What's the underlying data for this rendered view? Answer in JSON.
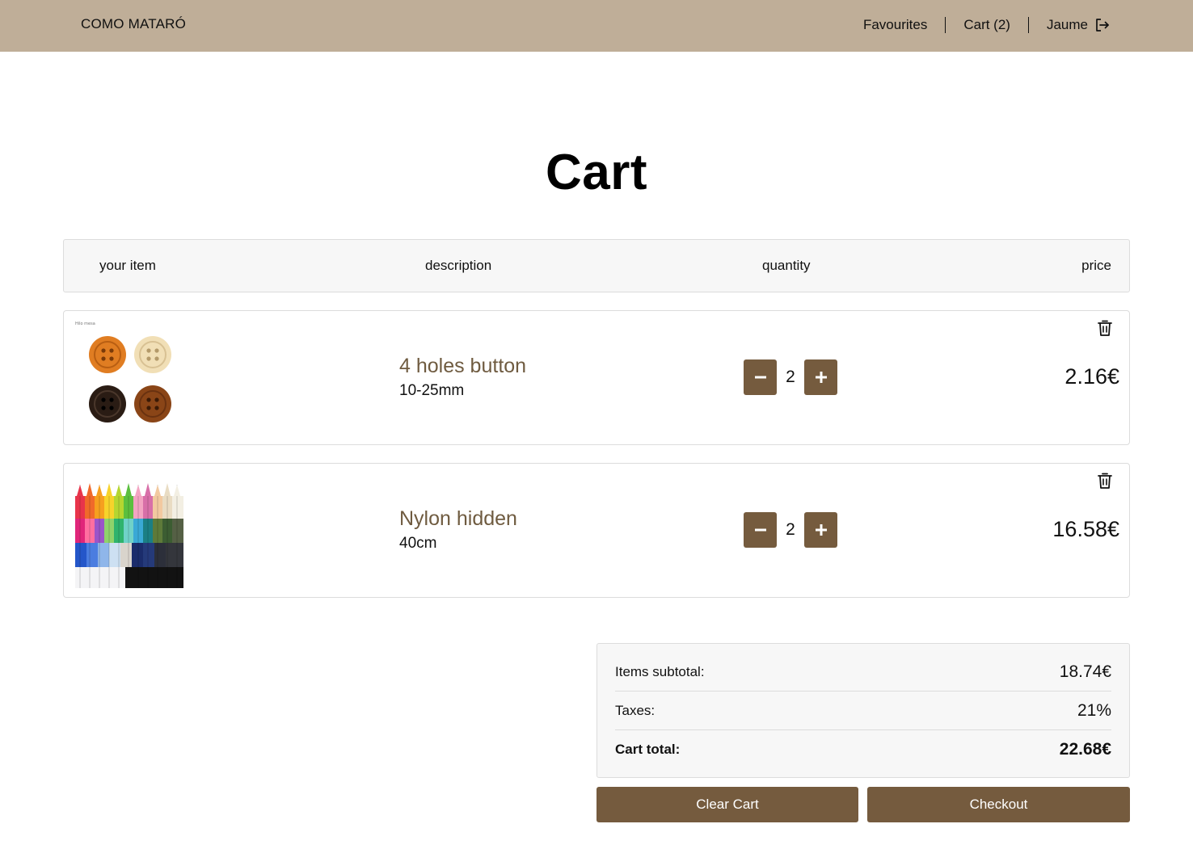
{
  "nav": {
    "brand": "COMO MATARÓ",
    "favourites": "Favourites",
    "cart": "Cart (2)",
    "user": "Jaume",
    "logout_icon": "logout-icon"
  },
  "page": {
    "title": "Cart"
  },
  "table": {
    "headers": {
      "item": "your item",
      "description": "description",
      "quantity": "quantity",
      "price": "price"
    }
  },
  "items": [
    {
      "image_icon": "buttons-image",
      "image_caption": "Hilo mesa",
      "name": "4 holes button",
      "size": "10-25mm",
      "quantity": "2",
      "price": "2.16€"
    },
    {
      "image_icon": "zippers-image",
      "name": "Nylon hidden",
      "size": "40cm",
      "quantity": "2",
      "price": "16.58€"
    }
  ],
  "summary": {
    "subtotal_label": "Items subtotal:",
    "subtotal_value": "18.74€",
    "taxes_label": "Taxes:",
    "taxes_value": "21%",
    "total_label": "Cart total:",
    "total_value": "22.68€"
  },
  "actions": {
    "clear": "Clear Cart",
    "checkout": "Checkout"
  },
  "colors": {
    "navbar": "#bfae98",
    "accent": "#755b3e",
    "item_name": "#6f5b40",
    "panel": "#f7f7f7"
  }
}
